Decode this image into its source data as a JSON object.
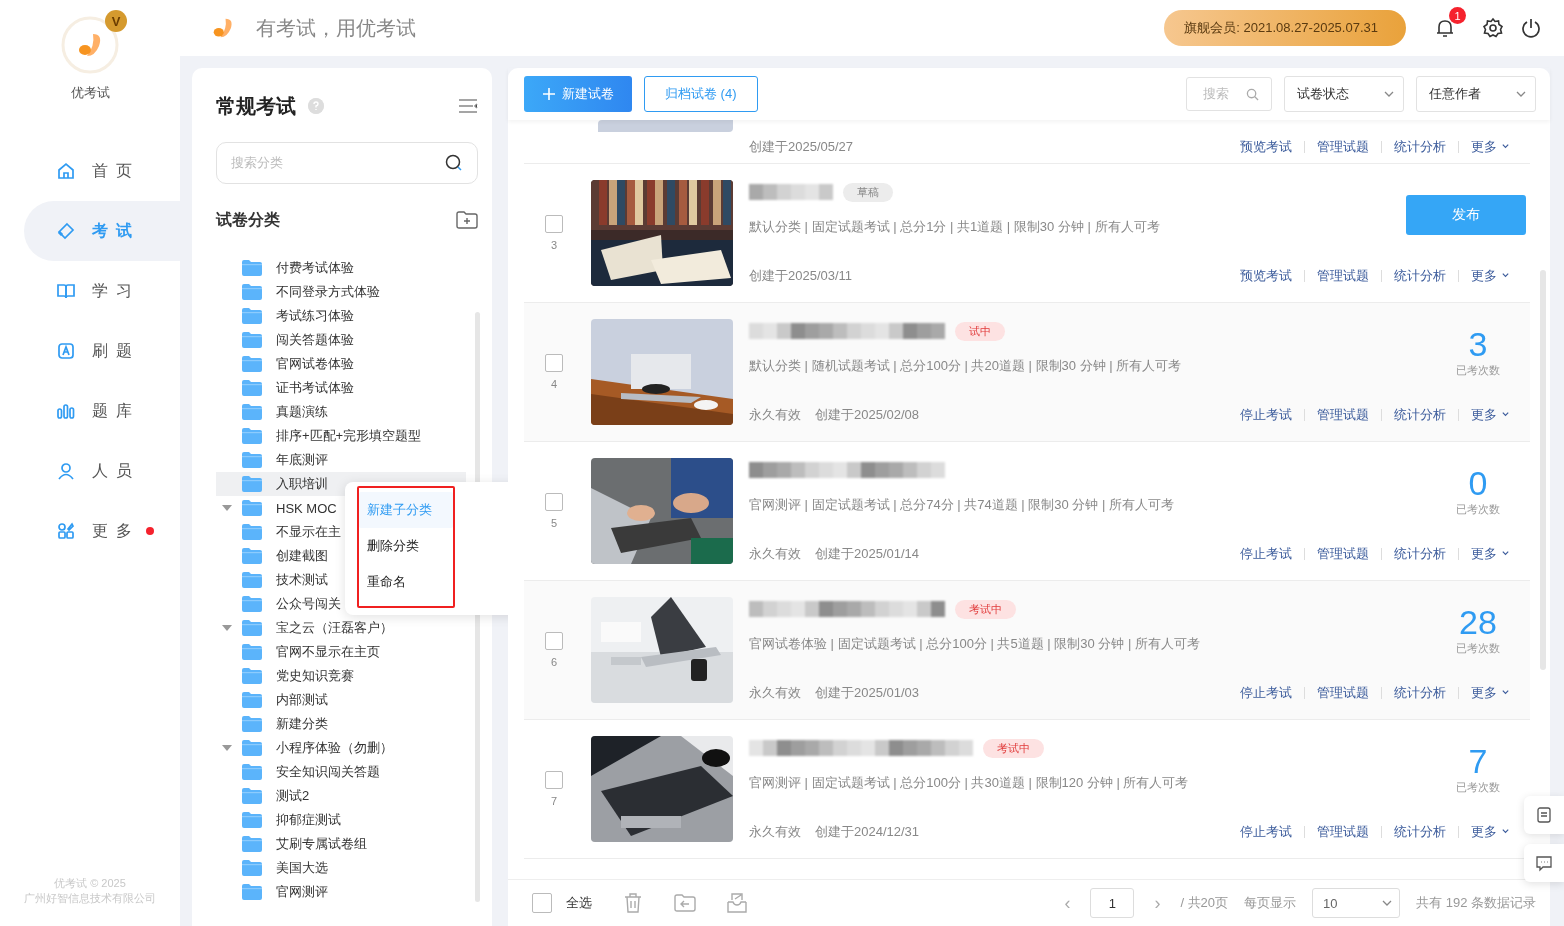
{
  "app": {
    "name": "优考试",
    "badge": "V"
  },
  "header": {
    "slogan": "有考试，用优考试",
    "membership": "旗舰会员: 2021.08.27-2025.07.31",
    "notification_count": "1"
  },
  "nav": [
    {
      "label": "首 页",
      "kind": "home",
      "selected": false,
      "dot": false
    },
    {
      "label": "考 试",
      "kind": "exam",
      "selected": true,
      "dot": false
    },
    {
      "label": "学 习",
      "kind": "study",
      "selected": false,
      "dot": false
    },
    {
      "label": "刷 题",
      "kind": "practice",
      "selected": false,
      "dot": false
    },
    {
      "label": "题 库",
      "kind": "bank",
      "selected": false,
      "dot": false
    },
    {
      "label": "人 员",
      "kind": "people",
      "selected": false,
      "dot": false
    },
    {
      "label": "更 多",
      "kind": "more",
      "selected": false,
      "dot": true
    }
  ],
  "footer": {
    "copyright": "优考试 © 2025",
    "company": "广州好智信息技术有限公司"
  },
  "category_panel": {
    "title": "常规考试",
    "search": {
      "placeholder": "搜索分类"
    },
    "section_title": "试卷分类",
    "categories": [
      {
        "label": "付费考试体验",
        "expandable": false,
        "selected": false
      },
      {
        "label": "不同登录方式体验",
        "expandable": false,
        "selected": false
      },
      {
        "label": "考试练习体验",
        "expandable": false,
        "selected": false
      },
      {
        "label": "闯关答题体验",
        "expandable": false,
        "selected": false
      },
      {
        "label": "官网试卷体验",
        "expandable": false,
        "selected": false
      },
      {
        "label": "证书考试体验",
        "expandable": false,
        "selected": false
      },
      {
        "label": "真题演练",
        "expandable": false,
        "selected": false
      },
      {
        "label": "排序+匹配+完形填空题型",
        "expandable": false,
        "selected": false
      },
      {
        "label": "年底测评",
        "expandable": false,
        "selected": false
      },
      {
        "label": "入职培训",
        "expandable": false,
        "selected": true
      },
      {
        "label": "HSK MOC",
        "expandable": true,
        "selected": false
      },
      {
        "label": "不显示在主",
        "expandable": false,
        "selected": false
      },
      {
        "label": "创建截图",
        "expandable": false,
        "selected": false
      },
      {
        "label": "技术测试",
        "expandable": false,
        "selected": false
      },
      {
        "label": "公众号闯关",
        "expandable": false,
        "selected": false
      },
      {
        "label": "宝之云（汪磊客户）",
        "expandable": true,
        "selected": false
      },
      {
        "label": "官网不显示在主页",
        "expandable": false,
        "selected": false
      },
      {
        "label": "党史知识竞赛",
        "expandable": false,
        "selected": false
      },
      {
        "label": "内部测试",
        "expandable": false,
        "selected": false
      },
      {
        "label": "新建分类",
        "expandable": false,
        "selected": false
      },
      {
        "label": "小程序体验（勿删）",
        "expandable": true,
        "selected": false
      },
      {
        "label": "安全知识闯关答题",
        "expandable": false,
        "selected": false
      },
      {
        "label": "测试2",
        "expandable": false,
        "selected": false
      },
      {
        "label": "抑郁症测试",
        "expandable": false,
        "selected": false
      },
      {
        "label": "艾刷专属试卷组",
        "expandable": false,
        "selected": false
      },
      {
        "label": "美国大选",
        "expandable": false,
        "selected": false
      },
      {
        "label": "官网测评",
        "expandable": false,
        "selected": false
      }
    ],
    "context_menu": {
      "highlighted": true,
      "items": [
        {
          "label": "新建子分类",
          "selected": true
        },
        {
          "label": "删除分类",
          "selected": false
        },
        {
          "label": "重命名",
          "selected": false
        }
      ]
    }
  },
  "toolbar": {
    "new_button": "新建试卷",
    "archive_button": "归档试卷 (4)",
    "search": {
      "placeholder": "搜索"
    },
    "status_filter": "试卷状态",
    "author_filter": "任意作者"
  },
  "exams": [
    {
      "kind": "partial",
      "created": "创建于2025/05/27",
      "actions": [
        "预览考试",
        "管理试题",
        "统计分析",
        "更多"
      ]
    },
    {
      "kind": "draft",
      "index": "3",
      "checked": false,
      "status": "草稿",
      "meta": "默认分类 | 固定试题考试 | 总分1分 | 共1道题 | 限制30 分钟 | 所有人可考",
      "created": "创建于2025/03/11",
      "publish_button": "发布",
      "actions": [
        "预览考试",
        "管理试题",
        "统计分析",
        "更多"
      ]
    },
    {
      "kind": "running",
      "index": "4",
      "checked": false,
      "status": "试中",
      "meta": "默认分类 | 随机试题考试 | 总分100分 | 共20道题 | 限制30 分钟 | 所有人可考",
      "validity": "永久有效",
      "created": "创建于2025/02/08",
      "count": "3",
      "count_label": "已考次数",
      "actions": [
        "停止考试",
        "管理试题",
        "统计分析",
        "更多"
      ]
    },
    {
      "kind": "running",
      "index": "5",
      "checked": false,
      "meta": "官网测评 | 固定试题考试 | 总分74分 | 共74道题 | 限制30 分钟 | 所有人可考",
      "validity": "永久有效",
      "created": "创建于2025/01/14",
      "count": "0",
      "count_label": "已考次数",
      "actions": [
        "停止考试",
        "管理试题",
        "统计分析",
        "更多"
      ]
    },
    {
      "kind": "running",
      "index": "6",
      "checked": false,
      "status": "考试中",
      "meta": "官网试卷体验 | 固定试题考试 | 总分100分 | 共5道题 | 限制30 分钟 | 所有人可考",
      "validity": "永久有效",
      "created": "创建于2025/01/03",
      "count": "28",
      "count_label": "已考次数",
      "actions": [
        "停止考试",
        "管理试题",
        "统计分析",
        "更多"
      ]
    },
    {
      "kind": "running",
      "index": "7",
      "checked": false,
      "status": "考试中",
      "meta": "官网测评 | 固定试题考试 | 总分100分 | 共30道题 | 限制120 分钟 | 所有人可考",
      "validity": "永久有效",
      "created": "创建于2024/12/31",
      "count": "7",
      "count_label": "已考次数",
      "actions": [
        "停止考试",
        "管理试题",
        "统计分析",
        "更多"
      ]
    }
  ],
  "list_footer": {
    "select_all": "全选",
    "checked": false,
    "prev": "‹",
    "page": "1",
    "next": "›",
    "total_pages": "/ 共20页",
    "page_size_label": "每页显示",
    "page_size": "10",
    "total_records": "共有 192 条数据记录"
  }
}
